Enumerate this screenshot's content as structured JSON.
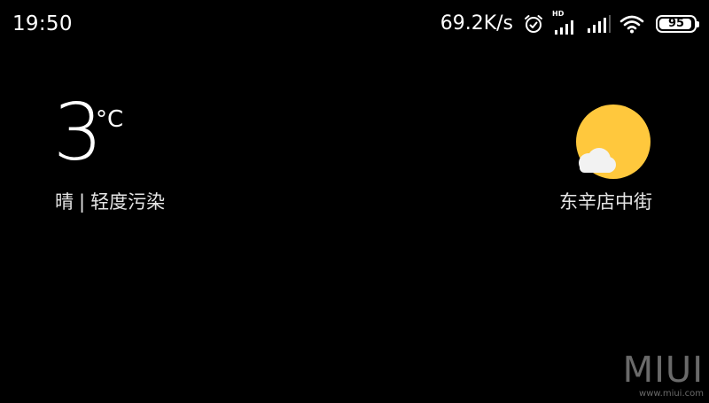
{
  "status_bar": {
    "time": "19:50",
    "net_speed": "69.2K/s",
    "alarm_icon": "alarm-clock-icon",
    "sim1_label": "HD",
    "sim1_icon": "cell-signal-icon",
    "sim2_icon": "cell-signal-icon",
    "wifi_icon": "wifi-icon",
    "battery_level": "95",
    "battery_fraction": 0.95
  },
  "weather": {
    "temperature": "3",
    "unit": "°C",
    "condition": "晴",
    "separator": "|",
    "air_quality": "轻度污染",
    "location": "东辛店中街",
    "icon": "sunny-with-cloud-icon",
    "colors": {
      "sun": "#FFC83D",
      "cloud": "#F2F2F2"
    }
  },
  "watermark": {
    "logo": "MIUI",
    "url": "www.miui.com"
  }
}
